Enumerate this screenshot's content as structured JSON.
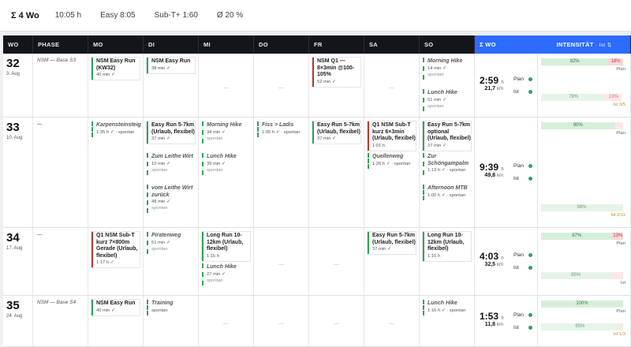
{
  "summary": {
    "title": "Σ 4 Wo",
    "total_time": "10:05 h",
    "easy": "Easy 8:05",
    "sub": "Sub-T+ 1:60",
    "avg": "Ø 20 %"
  },
  "headers": {
    "wo": "WO",
    "phase": "PHASE",
    "mo": "MO",
    "di": "DI",
    "mi": "MI",
    "do": "DO",
    "fr": "FR",
    "sa": "SA",
    "so": "SO",
    "sum_wo": "Σ WO",
    "intensitaet": "INTENSITÄT",
    "ist": "· Ist"
  },
  "labels": {
    "plan": "Plan",
    "ist": "Ist",
    "time_unit": "h",
    "km_unit": "km",
    "dash": "—"
  },
  "weeks": [
    {
      "num": "32",
      "date": "3. Aug",
      "phase": "NSM — Base S3",
      "time": "2:59",
      "km": "21,7",
      "plan_bar": {
        "green": "82%",
        "red": "18%"
      },
      "plan_label": "Plan",
      "ist_bar": {
        "green": "79%",
        "red": "19%"
      },
      "ist_label": "Ist 3/5",
      "mo": [
        {
          "title": "NSM Easy Run (KW32)",
          "meta": "40 min ✓"
        }
      ],
      "di": [
        {
          "title": "NSM Easy Run",
          "meta": "38 min ✓"
        }
      ],
      "fr": [
        {
          "title": "NSM Q1 — 8×3min @100-105%",
          "meta": "52 min ✓"
        }
      ],
      "so": [
        {
          "title": "Morning Hike",
          "meta": "14 min ✓",
          "meta2": "spontan"
        },
        {
          "title": "Lunch Hike",
          "meta": "51 min ✓",
          "meta2": "spontan"
        }
      ]
    },
    {
      "num": "33",
      "date": "10. Aug",
      "phase": "—",
      "time": "9:39",
      "km": "49,8",
      "plan_bar": {
        "green": "90%",
        "red": ""
      },
      "plan_label": "Plan",
      "ist_bar": {
        "green": "99%",
        "red": ""
      },
      "ist_label": "Ist 2/11",
      "mo": [
        {
          "title": "Karpensteinsteig",
          "meta": "1:35 h ✓ · spontan"
        }
      ],
      "di": [
        {
          "title": "Easy Run 5-7km (Urlaub, flexibel)",
          "meta": "37 min ✓"
        },
        {
          "title": "Zum Leithe Wirt",
          "meta": "10 min ✓",
          "meta2": "spontan"
        },
        {
          "title": "vom Leithe Wirt zurück",
          "meta": "48 min ✓",
          "meta2": "spontan"
        }
      ],
      "mi": [
        {
          "title": "Morning Hike",
          "meta": "34 min ✓",
          "meta2": "spontan"
        },
        {
          "title": "Lunch Hike",
          "meta": "39 min ✓",
          "meta2": "spontan"
        }
      ],
      "do": [
        {
          "title": "Fiss > Ladis",
          "meta": "1:05 h ✓ · spontan"
        }
      ],
      "fr": [
        {
          "title": "Easy Run 5-7km (Urlaub, flexibel)",
          "meta": "37 min ✓"
        }
      ],
      "sa": [
        {
          "title": "Q1 NSM Sub-T kurz 6×3min (Urlaub, flexibel)",
          "meta": "1:01 h"
        },
        {
          "title": "Quellenweg",
          "meta": "1:26 h ✓ · spontan"
        }
      ],
      "so": [
        {
          "title": "Easy Run 5-7km optional (Urlaub, flexibel)",
          "meta": "37 min ✓"
        },
        {
          "title": "Zur Schöngampalm",
          "meta": "1:13 h ✓ · spontan"
        },
        {
          "title": "Afternoon MTB",
          "meta": "1:00 h ✓ · spontan"
        }
      ]
    },
    {
      "num": "34",
      "date": "17. Aug",
      "phase": "—",
      "time": "4:03",
      "km": "32,5",
      "plan_bar": {
        "green": "87%",
        "red": "13%"
      },
      "plan_label": "Plan",
      "ist_bar": {
        "green": "85%",
        "red": ""
      },
      "ist_label": "Ist",
      "mo": [
        {
          "title": "Q1 NSM Sub-T kurz 7×800m Gerade (Urlaub, flexibel)",
          "meta": "1:17 h ✓"
        }
      ],
      "di": [
        {
          "title": "Piratenweg",
          "meta": "51 min ✓",
          "meta2": "spontan"
        }
      ],
      "mi": [
        {
          "title": "Long Run 10-12km (Urlaub, flexibel)",
          "meta": "1:15 h"
        },
        {
          "title": "Lunch Hike",
          "meta": "27 min ✓",
          "meta2": "spontan"
        }
      ],
      "sa": [
        {
          "title": "Easy Run 5-7km (Urlaub, flexibel)",
          "meta": "37 min ✓"
        }
      ],
      "so": [
        {
          "title": "Long Run 10-12km (Urlaub, flexibel)",
          "meta": "1:15 h"
        }
      ]
    },
    {
      "num": "35",
      "date": "24. Aug",
      "phase": "NSM — Base S4",
      "time": "1:53",
      "km": "11,8",
      "plan_bar": {
        "green": "100%",
        "red": ""
      },
      "plan_label": "Plan",
      "ist_bar": {
        "green": "95%",
        "red": ""
      },
      "ist_label": "Ist 1/3",
      "mo": [
        {
          "title": "NSM Easy Run",
          "meta": "40 min ✓"
        }
      ],
      "di": [
        {
          "title": "Training",
          "meta": "spontan"
        }
      ],
      "so": [
        {
          "title": "Lunch Hike",
          "meta": "1:16 h ✓ · spontan"
        }
      ]
    }
  ]
}
